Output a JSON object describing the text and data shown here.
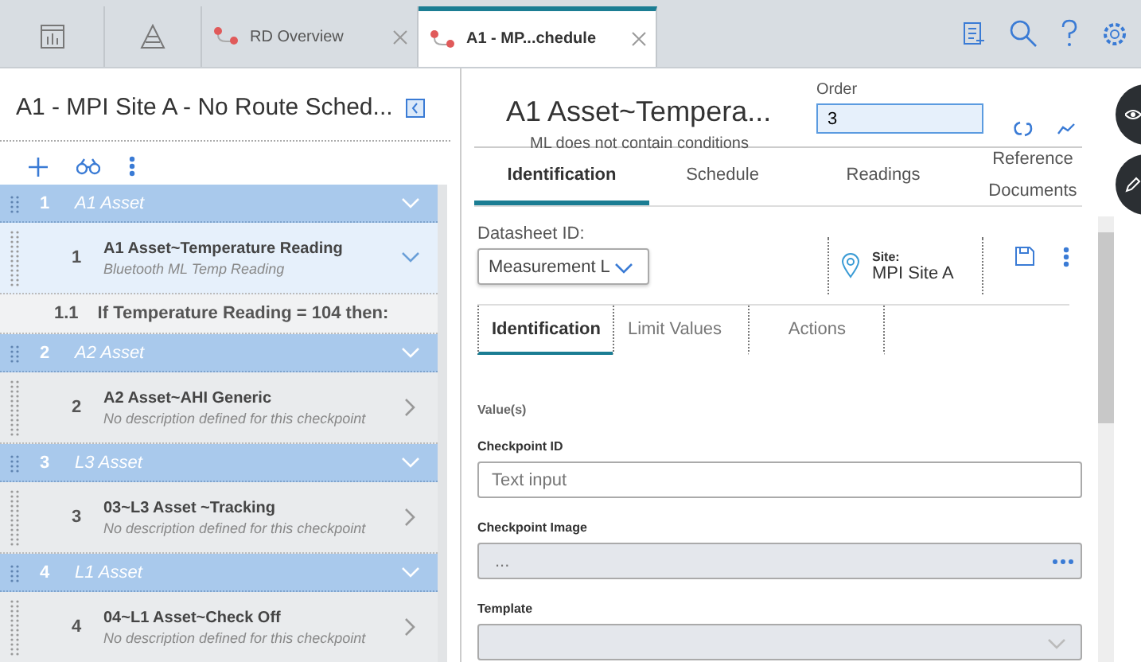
{
  "top_tabs": [
    {
      "kind": "chart",
      "selected": false
    },
    {
      "kind": "pyramid",
      "selected": false
    },
    {
      "kind": "route",
      "label": "RD Overview",
      "selected": false,
      "closable": true
    },
    {
      "kind": "route",
      "label": "A1 - MP...chedule",
      "selected": true,
      "closable": true
    }
  ],
  "route": {
    "title": "A1 - MPI Site A - No Route Sched...",
    "groups": [
      {
        "number": "1",
        "name": "A1 Asset",
        "expanded": true,
        "checkpoints": [
          {
            "number": "1",
            "title": "A1 Asset~Temperature Reading",
            "description": "Bluetooth ML Temp Reading",
            "selected": true,
            "expanded": true,
            "conditions": [
              {
                "number": "1.1",
                "text": "If Temperature Reading = 104 then:"
              }
            ]
          }
        ]
      },
      {
        "number": "2",
        "name": "A2 Asset",
        "expanded": true,
        "checkpoints": [
          {
            "number": "2",
            "title": "A2 Asset~AHI Generic",
            "description": "No description defined for this checkpoint",
            "selected": false,
            "expanded": false
          }
        ]
      },
      {
        "number": "3",
        "name": "L3 Asset",
        "expanded": true,
        "checkpoints": [
          {
            "number": "3",
            "title": "03~L3 Asset ~Tracking",
            "description": "No description defined for this checkpoint",
            "selected": false,
            "expanded": false
          }
        ]
      },
      {
        "number": "4",
        "name": "L1 Asset",
        "expanded": true,
        "checkpoints": [
          {
            "number": "4",
            "title": "04~L1 Asset~Check Off",
            "description": "No description defined for this checkpoint",
            "selected": false,
            "expanded": false
          }
        ]
      }
    ]
  },
  "detail": {
    "title": "A1 Asset~Tempera...",
    "subtitle": "ML does not contain conditions",
    "order": {
      "label": "Order",
      "value": "3"
    },
    "tabs": [
      {
        "label": "Identification",
        "selected": true
      },
      {
        "label": "Schedule",
        "selected": false
      },
      {
        "label": "Readings",
        "selected": false
      },
      {
        "label": "Reference Documents",
        "selected": false
      }
    ],
    "datasheet": {
      "label": "Datasheet ID:",
      "value": "Measurement L"
    },
    "site": {
      "label": "Site:",
      "value": "MPI Site A"
    },
    "sub_tabs": [
      {
        "label": "Identification",
        "selected": true
      },
      {
        "label": "Limit Values",
        "selected": false
      },
      {
        "label": "Actions",
        "selected": false
      }
    ],
    "section": "Value(s)",
    "fields": [
      {
        "kind": "text",
        "label": "Checkpoint ID",
        "placeholder": "Text input",
        "disabled": false
      },
      {
        "kind": "browse",
        "label": "Checkpoint Image",
        "placeholder": "...",
        "disabled": true
      },
      {
        "kind": "select",
        "label": "Template",
        "disabled": true
      }
    ]
  }
}
